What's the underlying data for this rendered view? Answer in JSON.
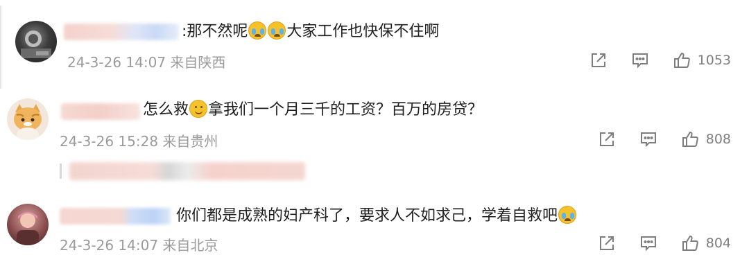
{
  "comments": [
    {
      "content_parts": [
        ":那不然呢",
        "大家工作也快保不住啊"
      ],
      "time": "24-3-26 14:07",
      "location": "来自陕西",
      "likes": "1053",
      "emojis": [
        "cry-emoji",
        "cry-emoji"
      ]
    },
    {
      "content_parts": [
        "怎么救",
        "拿我们一个月三千的工资？百万的房贷？"
      ],
      "time": "24-3-26 15:28",
      "location": "来自贵州",
      "likes": "808",
      "emojis": [
        "smile-emoji"
      ]
    },
    {
      "content_parts": [
        "你们都是成熟的妇产科了，要求人不如求己，学着自救吧"
      ],
      "time": "24-3-26 14:07",
      "location": "来自北京",
      "likes": "804",
      "emojis": [
        "cry-emoji"
      ]
    }
  ],
  "icons": {
    "share": "share-icon",
    "comment": "comment-icon",
    "like": "like-icon"
  },
  "colors": {
    "meta": "#9a9a9a",
    "icon": "#7d7d7d",
    "text": "#1f1f1f"
  }
}
